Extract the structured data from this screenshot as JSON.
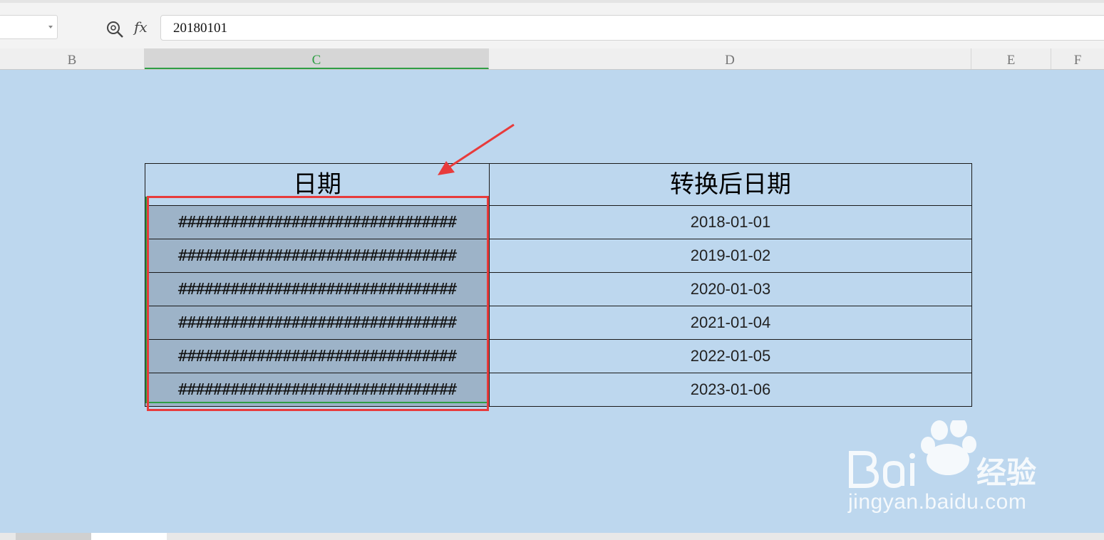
{
  "formula_bar": {
    "zoom_icon": "search-zoom-icon",
    "fx_label": "fx",
    "value": "20180101"
  },
  "columns": [
    {
      "label": "B"
    },
    {
      "label": "C",
      "selected": true
    },
    {
      "label": "D"
    },
    {
      "label": "E"
    },
    {
      "label": "F"
    }
  ],
  "table": {
    "headers": [
      "日期",
      "转换后日期"
    ],
    "rows": [
      {
        "original": "################################",
        "converted": "2018-01-01"
      },
      {
        "original": "################################",
        "converted": "2019-01-02"
      },
      {
        "original": "################################",
        "converted": "2020-01-03"
      },
      {
        "original": "################################",
        "converted": "2021-01-04"
      },
      {
        "original": "################################",
        "converted": "2022-01-05"
      },
      {
        "original": "################################",
        "converted": "2023-01-06"
      }
    ]
  },
  "annotation": {
    "color": "#e83b3b"
  },
  "watermark": {
    "brand": "Bai du 经验",
    "url": "jingyan.baidu.com"
  }
}
